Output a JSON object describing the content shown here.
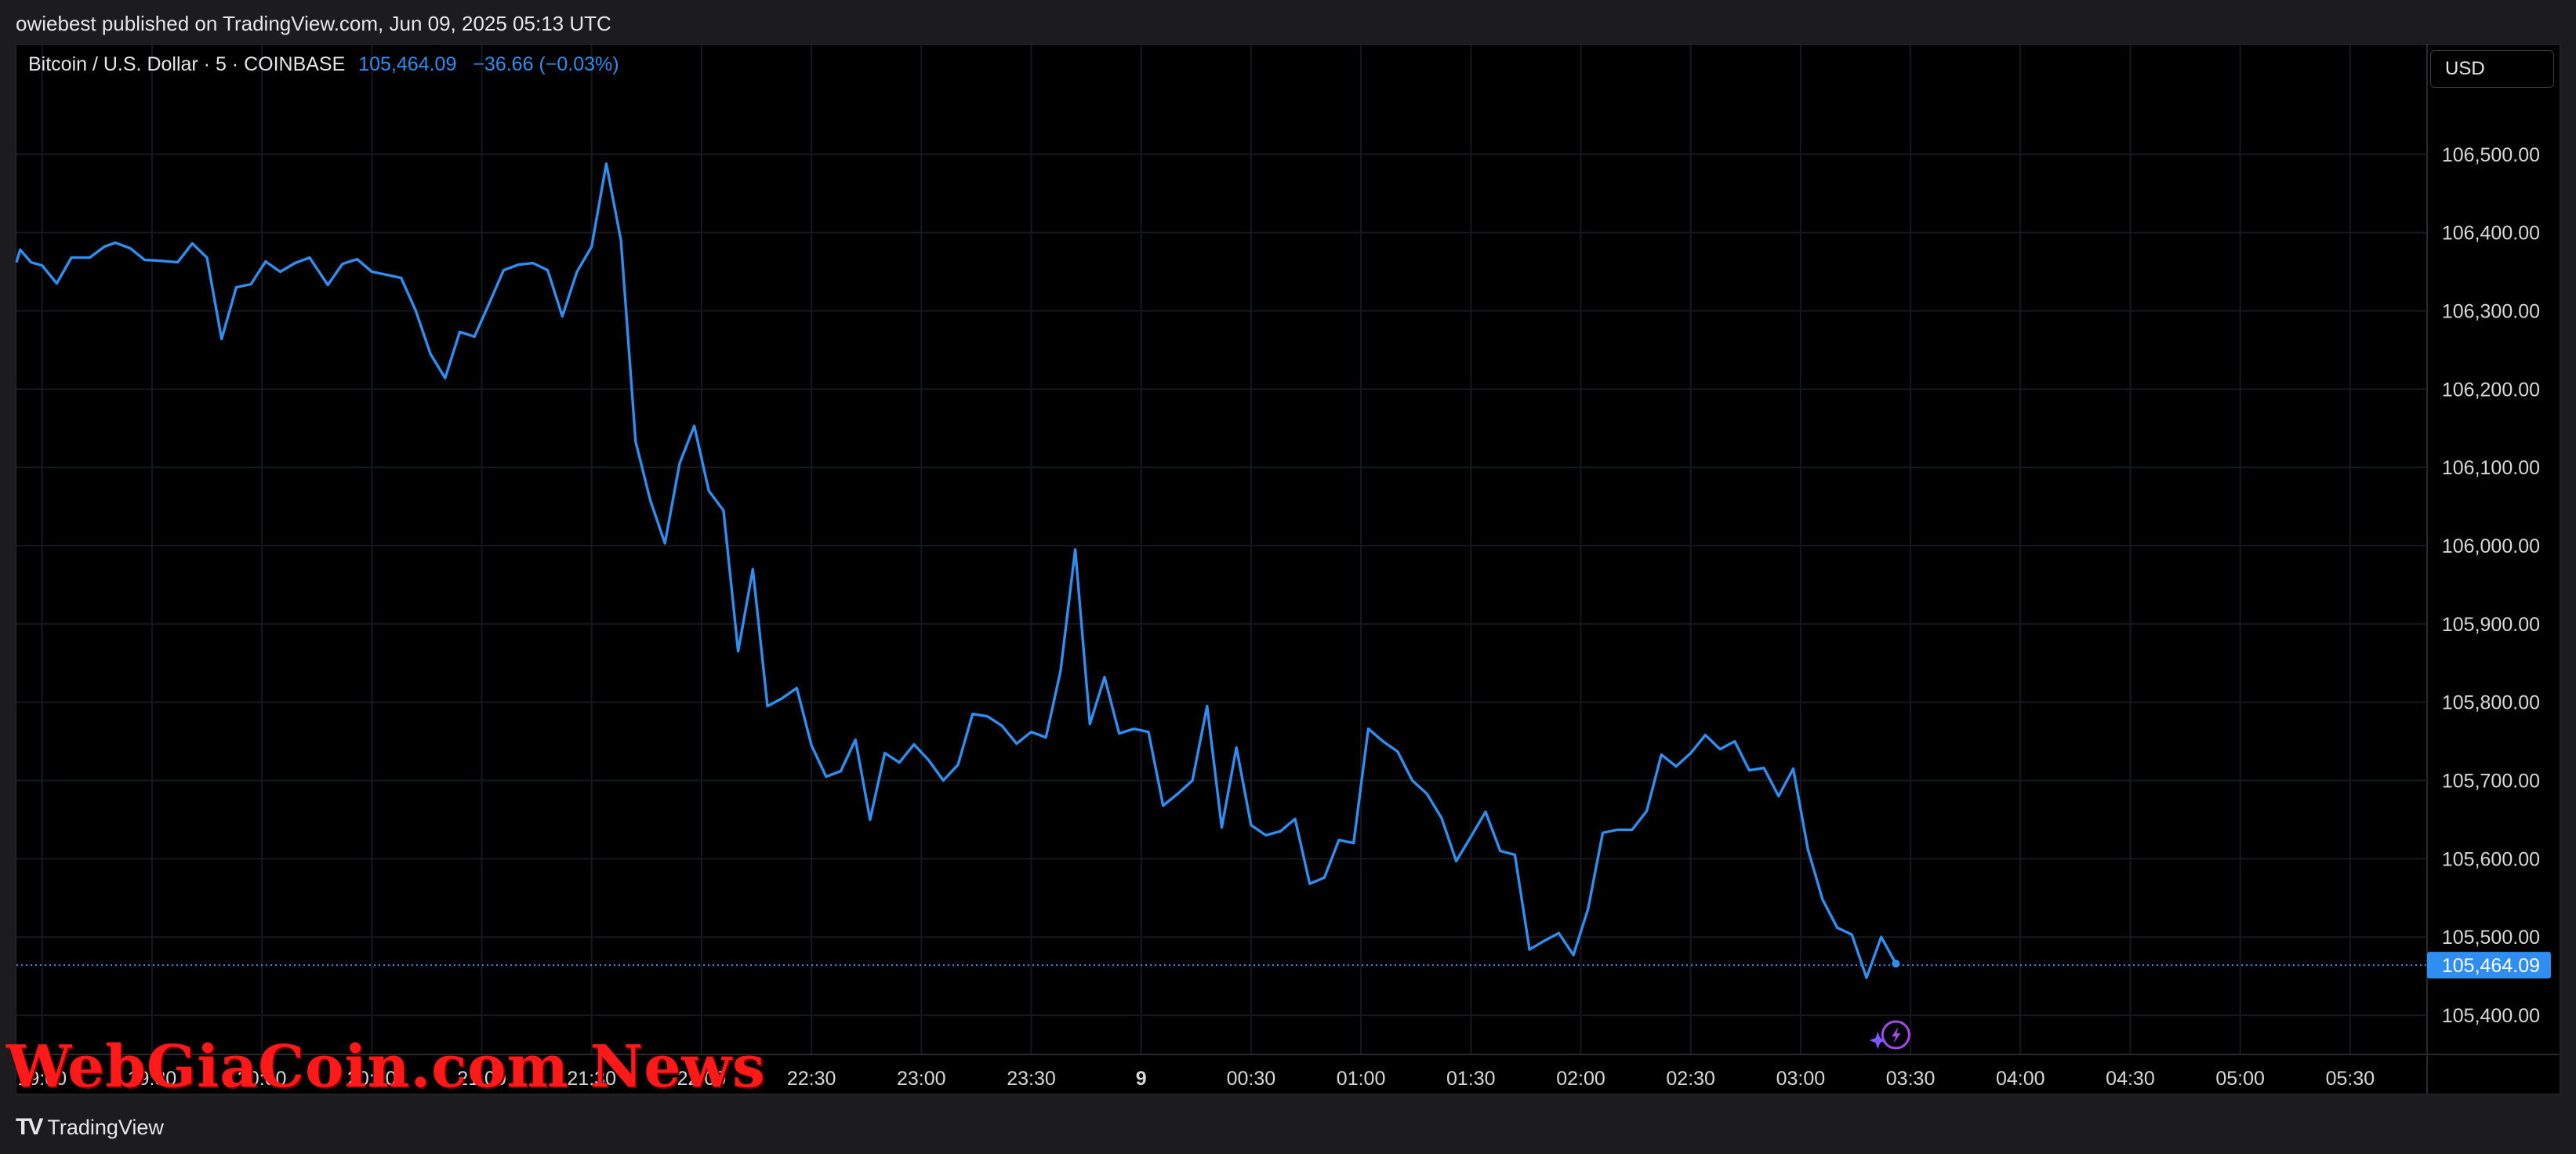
{
  "header": {
    "published_text": "owiebest published on TradingView.com, Jun 09, 2025 05:13 UTC"
  },
  "symbol": {
    "name": "Bitcoin / U.S. Dollar · 5 · COINBASE",
    "price": "105,464.09",
    "change": "−36.66 (−0.03%)"
  },
  "currency": "USD",
  "last_price_label": "105,464.09",
  "brand": {
    "logo_text": "TradingView"
  },
  "watermark": "WebGiaCoin.com News",
  "colors": {
    "line": "#2f8ef0",
    "background": "#000000",
    "grid": "#16181d",
    "axis_text": "#d8d8d8"
  },
  "chart_data": {
    "type": "line",
    "title": "Bitcoin / U.S. Dollar · 5 · COINBASE",
    "xlabel": "",
    "ylabel": "",
    "y_ticks": [
      106500,
      106400,
      106300,
      106200,
      106100,
      106000,
      105900,
      105800,
      105700,
      105600,
      105500,
      105400
    ],
    "y_tick_labels": [
      "106,500.00",
      "106,400.00",
      "106,300.00",
      "106,200.00",
      "106,100.00",
      "106,000.00",
      "105,900.00",
      "105,800.00",
      "105,700.00",
      "105,600.00",
      "105,500.00",
      "105,400.00"
    ],
    "ylim": [
      105350,
      106640
    ],
    "x_range_minutes": [
      1133,
      1791
    ],
    "x_ticks": [
      {
        "label": "19:00",
        "t": 1140
      },
      {
        "label": "19:30",
        "t": 1170
      },
      {
        "label": "20:00",
        "t": 1200
      },
      {
        "label": "20:30",
        "t": 1230
      },
      {
        "label": "21:00",
        "t": 1260
      },
      {
        "label": "21:30",
        "t": 1290
      },
      {
        "label": "22:00",
        "t": 1320
      },
      {
        "label": "22:30",
        "t": 1350
      },
      {
        "label": "23:00",
        "t": 1380
      },
      {
        "label": "23:30",
        "t": 1410
      },
      {
        "label": "9",
        "t": 1440,
        "bold": true
      },
      {
        "label": "00:30",
        "t": 1470
      },
      {
        "label": "01:00",
        "t": 1500
      },
      {
        "label": "01:30",
        "t": 1530
      },
      {
        "label": "02:00",
        "t": 1560
      },
      {
        "label": "02:30",
        "t": 1590
      },
      {
        "label": "03:00",
        "t": 1620
      },
      {
        "label": "03:30",
        "t": 1650
      },
      {
        "label": "04:00",
        "t": 1680
      },
      {
        "label": "04:30",
        "t": 1710
      },
      {
        "label": "05:00",
        "t": 1740
      },
      {
        "label": "05:30",
        "t": 1770
      }
    ],
    "last_value": 105464.09,
    "series": [
      {
        "values": [
          [
            1133,
            106362
          ],
          [
            1134,
            106378
          ],
          [
            1137,
            106362
          ],
          [
            1140,
            106358
          ],
          [
            1144,
            106335
          ],
          [
            1148,
            106368
          ],
          [
            1153,
            106368
          ],
          [
            1157,
            106382
          ],
          [
            1160,
            106387
          ],
          [
            1164,
            106380
          ],
          [
            1168,
            106365
          ],
          [
            1172,
            106364
          ],
          [
            1177,
            106362
          ],
          [
            1181,
            106386
          ],
          [
            1185,
            106368
          ],
          [
            1189,
            106264
          ],
          [
            1193,
            106330
          ],
          [
            1197,
            106334
          ],
          [
            1201,
            106363
          ],
          [
            1205,
            106350
          ],
          [
            1209,
            106361
          ],
          [
            1213,
            106368
          ],
          [
            1218,
            106333
          ],
          [
            1222,
            106360
          ],
          [
            1226,
            106366
          ],
          [
            1230,
            106350
          ],
          [
            1234,
            106346
          ],
          [
            1238,
            106342
          ],
          [
            1242,
            106300
          ],
          [
            1246,
            106245
          ],
          [
            1250,
            106214
          ],
          [
            1254,
            106273
          ],
          [
            1258,
            106267
          ],
          [
            1262,
            106309
          ],
          [
            1266,
            106352
          ],
          [
            1270,
            106359
          ],
          [
            1274,
            106361
          ],
          [
            1278,
            106352
          ],
          [
            1282,
            106293
          ],
          [
            1286,
            106350
          ],
          [
            1290,
            106382
          ],
          [
            1294,
            106488
          ],
          [
            1298,
            106390
          ],
          [
            1302,
            106133
          ],
          [
            1306,
            106058
          ],
          [
            1310,
            106003
          ],
          [
            1314,
            106105
          ],
          [
            1318,
            106153
          ],
          [
            1322,
            106070
          ],
          [
            1326,
            106045
          ],
          [
            1330,
            105865
          ],
          [
            1334,
            105970
          ],
          [
            1338,
            105795
          ],
          [
            1342,
            105805
          ],
          [
            1346,
            105818
          ],
          [
            1350,
            105745
          ],
          [
            1354,
            105705
          ],
          [
            1358,
            105712
          ],
          [
            1362,
            105752
          ],
          [
            1366,
            105650
          ],
          [
            1370,
            105735
          ],
          [
            1374,
            105723
          ],
          [
            1378,
            105746
          ],
          [
            1382,
            105726
          ],
          [
            1386,
            105700
          ],
          [
            1390,
            105720
          ],
          [
            1394,
            105785
          ],
          [
            1398,
            105782
          ],
          [
            1402,
            105770
          ],
          [
            1406,
            105747
          ],
          [
            1410,
            105762
          ],
          [
            1414,
            105755
          ],
          [
            1418,
            105840
          ],
          [
            1422,
            105995
          ],
          [
            1426,
            105772
          ],
          [
            1430,
            105832
          ],
          [
            1434,
            105760
          ],
          [
            1438,
            105766
          ],
          [
            1442,
            105762
          ],
          [
            1446,
            105668
          ],
          [
            1450,
            105683
          ],
          [
            1454,
            105700
          ],
          [
            1458,
            105795
          ],
          [
            1462,
            105640
          ],
          [
            1466,
            105742
          ],
          [
            1470,
            105643
          ],
          [
            1474,
            105630
          ],
          [
            1478,
            105635
          ],
          [
            1482,
            105651
          ],
          [
            1486,
            105568
          ],
          [
            1490,
            105576
          ],
          [
            1494,
            105624
          ],
          [
            1498,
            105620
          ],
          [
            1502,
            105766
          ],
          [
            1506,
            105750
          ],
          [
            1510,
            105737
          ],
          [
            1514,
            105700
          ],
          [
            1518,
            105683
          ],
          [
            1522,
            105652
          ],
          [
            1526,
            105597
          ],
          [
            1530,
            105628
          ],
          [
            1534,
            105660
          ],
          [
            1538,
            105610
          ],
          [
            1542,
            105605
          ],
          [
            1546,
            105484
          ],
          [
            1550,
            105495
          ],
          [
            1554,
            105505
          ],
          [
            1558,
            105477
          ],
          [
            1562,
            105536
          ],
          [
            1566,
            105633
          ],
          [
            1570,
            105637
          ],
          [
            1574,
            105637
          ],
          [
            1578,
            105661
          ],
          [
            1582,
            105733
          ],
          [
            1586,
            105718
          ],
          [
            1590,
            105735
          ],
          [
            1594,
            105758
          ],
          [
            1598,
            105740
          ],
          [
            1602,
            105750
          ],
          [
            1606,
            105713
          ],
          [
            1610,
            105716
          ],
          [
            1614,
            105680
          ],
          [
            1618,
            105715
          ],
          [
            1622,
            105612
          ],
          [
            1626,
            105548
          ],
          [
            1630,
            105512
          ],
          [
            1634,
            105503
          ],
          [
            1638,
            105448
          ],
          [
            1642,
            105500
          ],
          [
            1646,
            105466
          ]
        ]
      }
    ]
  }
}
